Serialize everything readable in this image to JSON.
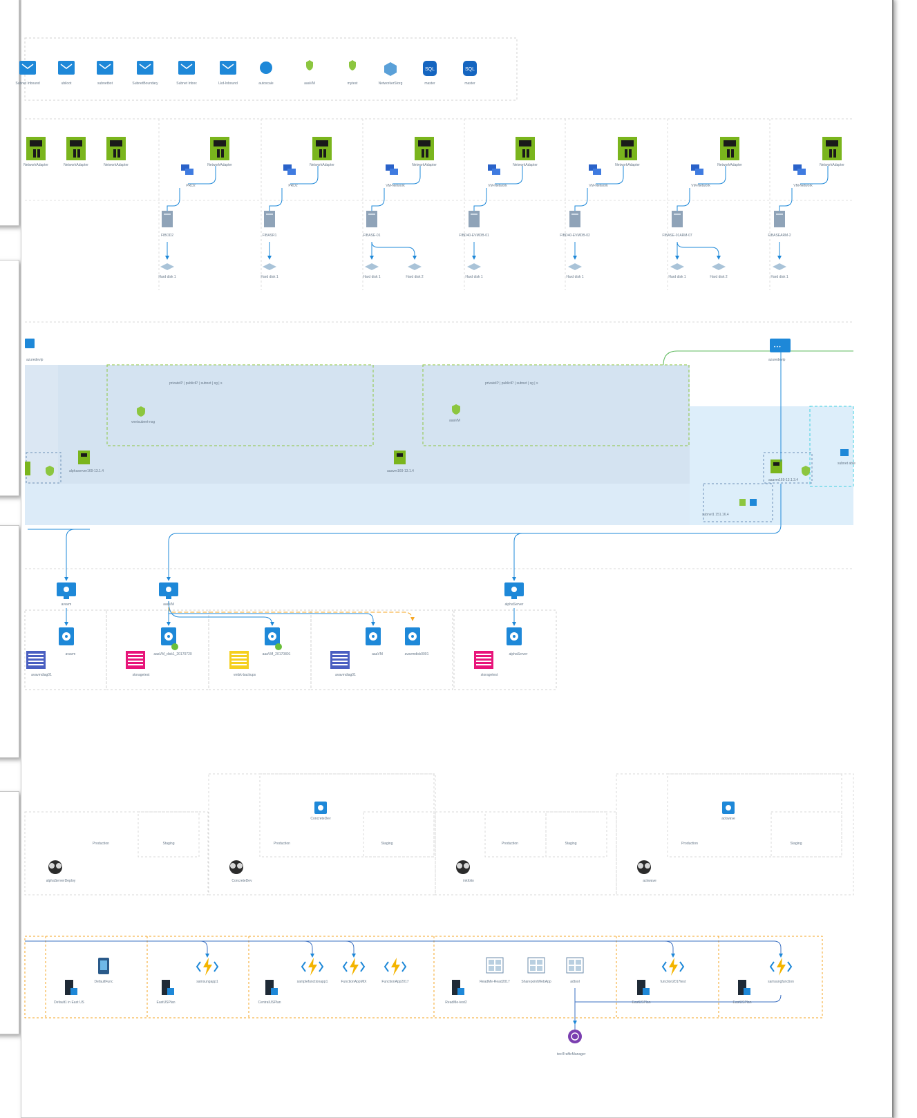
{
  "top_row": [
    {
      "label": "Subnet Inbound"
    },
    {
      "label": "ubiloot"
    },
    {
      "label": "subnetbot"
    },
    {
      "label": "SubnetBoundary"
    },
    {
      "label": "Subnet Inbox"
    },
    {
      "label": "Lkd-Inbound"
    },
    {
      "label": "autoscale"
    },
    {
      "label": "aaaVM"
    },
    {
      "label": "mytest"
    },
    {
      "label": "NetworkerStorg"
    },
    {
      "label": "master"
    },
    {
      "label": "master"
    }
  ],
  "adapters_row": [
    "NetworkAdapter",
    "NetworkAdapter",
    "NetworkAdapter",
    "NetworkAdapter",
    "NetworkAdapter",
    "NetworkAdapter",
    "NetworkAdapter",
    "NetworkAdapter",
    "NetworkAdapter",
    "NetworkAdapter",
    "NetworkAdapter"
  ],
  "vnet_labels": [
    "PRD2",
    "PRD2",
    "VM-Network",
    "VM-Network",
    "VM-Network",
    "VM-Network",
    "VM-Network"
  ],
  "servers": [
    {
      "name": "FIBOD2"
    },
    {
      "name": "FIBASR1"
    },
    {
      "name": "FIBASE-01"
    },
    {
      "name": "FIBD40-EVMDB-01"
    },
    {
      "name": "FIBD40-EVMDB-02"
    },
    {
      "name": "FIBASE-01ARM-07"
    },
    {
      "name": "FIBASEARM-2"
    }
  ],
  "disks": [
    "Hard disk 1",
    "Hard disk 1",
    "Hard disk 1",
    "Hard disk 2",
    "Hard disk 1",
    "Hard disk 1",
    "Hard disk 1",
    "Hard disk 2",
    "Hard disk 1"
  ],
  "network_section": {
    "vnet_left": "azuredevip",
    "vnet_right": "azuredevip",
    "subnet_left_caption": "privateIP | publicIP | subnet | sg | s",
    "subnet_right_caption": "privateIP | publicIP | subnet | sg | s",
    "nsg_left": "vnetsubnet-nsg",
    "nsg_right": "aaaVM",
    "nic_left": "alphaserver169-13.1.4",
    "nic_mid": "aaavm169-13.1.4",
    "nic_right": "aaavm169-13.1.3.4",
    "lb_label": "subnet1 151.16.4",
    "right_app": "subnet able"
  },
  "vms": [
    {
      "name": "avavm"
    },
    {
      "name": "aaaVM"
    },
    {
      "name": "alphaServer"
    }
  ],
  "vm_disks": [
    {
      "name": "avavm",
      "store": "avavmdiag01"
    },
    {
      "name": "aaaVM_disk1_20170720",
      "store": "storagetest"
    },
    {
      "name": "aaaVM_20170801",
      "store": "vmbk-backups"
    },
    {
      "name": "aaaVM",
      "store": "avavmdiag01"
    },
    {
      "name": "avavmdisk0001",
      "store": ""
    },
    {
      "name": "alphaServer",
      "store": "storagetest"
    }
  ],
  "cloud_services": [
    {
      "name": "alphaServerDeploy",
      "prod": "Production",
      "stage": "Staging",
      "role": ""
    },
    {
      "name": "ConcreteDev",
      "prod": "Production",
      "stage": "Staging",
      "role": "ConcreteDev"
    },
    {
      "name": "inkfolio",
      "prod": "Production",
      "stage": "Staging",
      "role": ""
    },
    {
      "name": "ackwave",
      "prod": "Production",
      "stage": "Staging",
      "role": "ackwave"
    }
  ],
  "app_services": [
    {
      "plan": "Default1 in East US",
      "app": "DefaultFunc"
    },
    {
      "plan": "EastUSPlan",
      "app": "samsungapp1"
    },
    {
      "plan": "CentralUSPlan",
      "app": "samplefunctionapp1"
    },
    {
      "plan": "CentralUSPlan",
      "app": "FunctionAppMIX"
    },
    {
      "plan": "CentralUSPlan",
      "app": "FunctionApp2017"
    },
    {
      "plan": "ReadMe-test2",
      "app": "ReadMe-Read2017"
    },
    {
      "plan": "ReadMe-test2",
      "app": "SharepointWebApp"
    },
    {
      "plan": "ReadMe-test2",
      "app": "adtool"
    },
    {
      "plan": "EastUSPlan",
      "app": "function2017test"
    },
    {
      "plan": "EastUSPlan",
      "app": "samsungfunction"
    }
  ],
  "traffic_manager": "testTrafficManager",
  "colors": {
    "azure_blue": "#1e88d8",
    "nic_green": "#7ab51d",
    "nsg_green": "#8cc63f",
    "sql_blue": "#1565c0",
    "storage_pink": "#e8157a",
    "storage_yellow": "#f5d020",
    "storage_purple": "#4a5fc1",
    "function_yellow": "#f4b400",
    "appservice_border": "#f5a623",
    "traffic_purple": "#7b3fb0"
  }
}
